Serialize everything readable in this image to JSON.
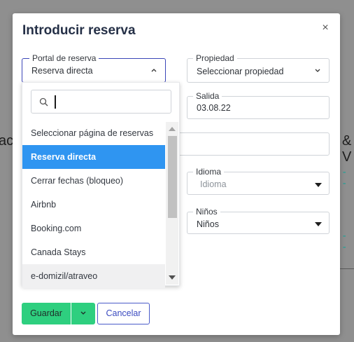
{
  "background": {
    "frag_left": "ac",
    "frag_right": "& V",
    "dash_top": "- -",
    "dash_bottom": "- -"
  },
  "modal": {
    "title": "Introducir reserva",
    "close_glyph": "×"
  },
  "fields": {
    "portal": {
      "label": "Portal de reserva",
      "value": "Reserva directa"
    },
    "property": {
      "label": "Propiedad",
      "value": "Seleccionar propiedad"
    },
    "departure": {
      "label": "Salida",
      "value": "03.08.22"
    },
    "language": {
      "label": "Idioma",
      "placeholder": "Idioma"
    },
    "children": {
      "label": "Niños",
      "value": "Niños"
    }
  },
  "dropdown": {
    "search_placeholder": "",
    "options": [
      "Seleccionar página de reservas",
      "Reserva directa",
      "Cerrar fechas (bloqueo)",
      "Airbnb",
      "Booking.com",
      "Canada Stays",
      "e-domizil/atraveo"
    ],
    "selected_option": "Reserva directa",
    "hovered_option": "e-domizil/atraveo"
  },
  "buttons": {
    "save": "Guardar",
    "cancel": "Cancelar"
  },
  "colors": {
    "accent_green": "#2ecf7f",
    "selected_blue": "#2f95f1",
    "active_border": "#3b46b8",
    "cancel_blue": "#3b4bc0"
  }
}
